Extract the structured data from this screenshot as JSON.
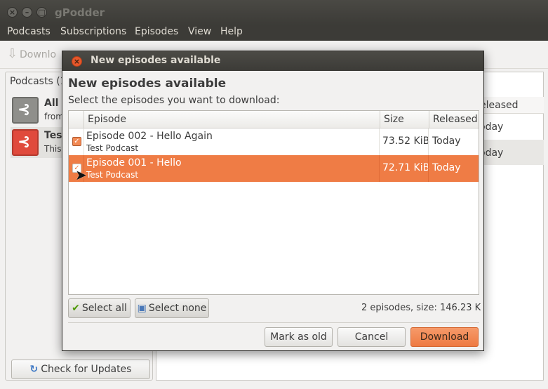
{
  "main_window": {
    "title": "gPodder",
    "menu": [
      "Podcasts",
      "Subscriptions",
      "Episodes",
      "View",
      "Help"
    ],
    "toolbar": {
      "download_label": "Downlo"
    },
    "podcasts_tab_label": "Podcasts (1",
    "podcast_list": [
      {
        "title": "All",
        "subtitle": "from",
        "icon": "rss-gray-icon"
      },
      {
        "title": "Tes",
        "subtitle": "This",
        "icon": "rss-red-icon"
      }
    ],
    "check_updates_label": "Check for Updates",
    "episode_pane": {
      "released_header": "eleased",
      "rows": [
        "oday",
        "oday"
      ]
    }
  },
  "dialog": {
    "title": "New episodes available",
    "heading": "New episodes available",
    "instructions": "Select the episodes you want to download:",
    "columns": {
      "episode": "Episode",
      "size": "Size",
      "released": "Released"
    },
    "episodes": [
      {
        "title": "Episode 002 - Hello Again",
        "podcast": "Test Podcast",
        "size": "73.52 KiB",
        "released": "Today",
        "checked": true,
        "selected": false
      },
      {
        "title": "Episode 001 - Hello",
        "podcast": "Test Podcast",
        "size": "72.71 KiB",
        "released": "Today",
        "checked": true,
        "selected": true
      }
    ],
    "select_all_label": "Select all",
    "select_none_label": "Select none",
    "summary": "2 episodes, size: 146.23 K",
    "buttons": {
      "mark_old": "Mark as old",
      "cancel": "Cancel",
      "download": "Download"
    }
  },
  "colors": {
    "accent": "#ef7c45",
    "titlebar": "#3c3b37"
  }
}
